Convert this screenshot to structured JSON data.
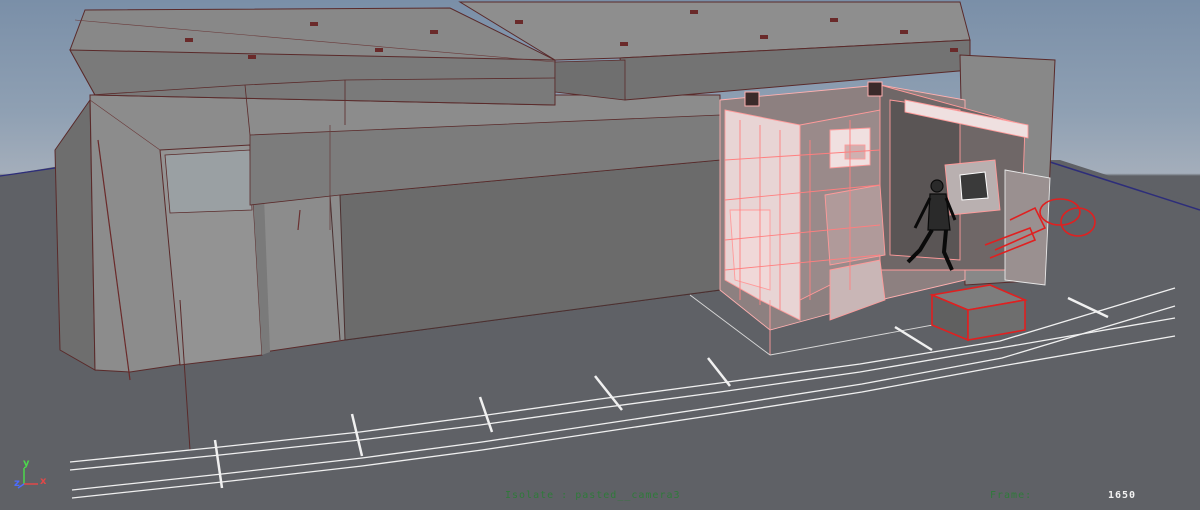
{
  "viewport": {
    "hud": {
      "camera_label": "Isolate : pasted__camera3",
      "frame_label": "Frame:",
      "frame_value": "1650"
    },
    "axis_gizmo": {
      "x": "x",
      "y": "y",
      "z": "z"
    },
    "colors": {
      "sky_top": "#7a8fa8",
      "ground": "#5f6166",
      "building_grey": "#8f8f8f",
      "selection_pink": "#ff9a9a",
      "selection_red": "#e02020",
      "wire_white": "#f0f0f0",
      "hud_green": "#2f7a3a"
    }
  }
}
